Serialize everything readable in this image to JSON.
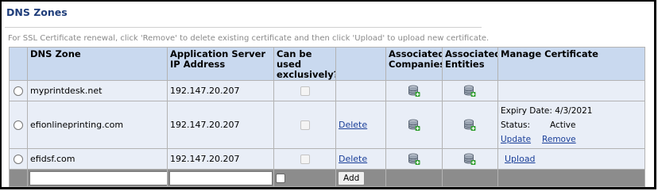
{
  "page": {
    "title": "DNS Zones",
    "hint": "For SSL Certificate renewal, click 'Remove' to delete existing certificate and then click 'Upload' to upload new certificate."
  },
  "table": {
    "headers": {
      "dns_zone": "DNS Zone",
      "app_server_ip_1": "Application Server",
      "app_server_ip_2": "IP Address",
      "exclusive_1": "Can be used",
      "exclusive_2": "exclusively?",
      "companies_1": "Associated",
      "companies_2": "Companies",
      "entities_1": "Associated",
      "entities_2": "Entities",
      "manage_cert": "Manage Certificate"
    },
    "rows": [
      {
        "zone": "myprintdesk.net",
        "ip": "192.147.20.207",
        "action": ""
      },
      {
        "zone": "efionlineprinting.com",
        "ip": "192.147.20.207",
        "action": "Delete",
        "cert": {
          "expiry_label": "Expiry Date:",
          "expiry_value": "4/3/2021",
          "status_label": "Status:",
          "status_value": "Active",
          "update": "Update",
          "remove": "Remove"
        }
      },
      {
        "zone": "efidsf.com",
        "ip": "192.147.20.207",
        "action": "Delete",
        "upload": "Upload"
      }
    ],
    "new_row": {
      "zone_value": "",
      "ip_value": "",
      "add_label": "Add"
    }
  },
  "icons": {
    "associated": "database-add-icon",
    "radio": "radio-button",
    "checkbox": "checkbox"
  },
  "colors": {
    "header_bg": "#c9d9ef",
    "row_bg": "#e9eef7",
    "new_row_bg": "#8c8c8c",
    "title": "#1f3d7a",
    "link": "#1a3f99"
  }
}
